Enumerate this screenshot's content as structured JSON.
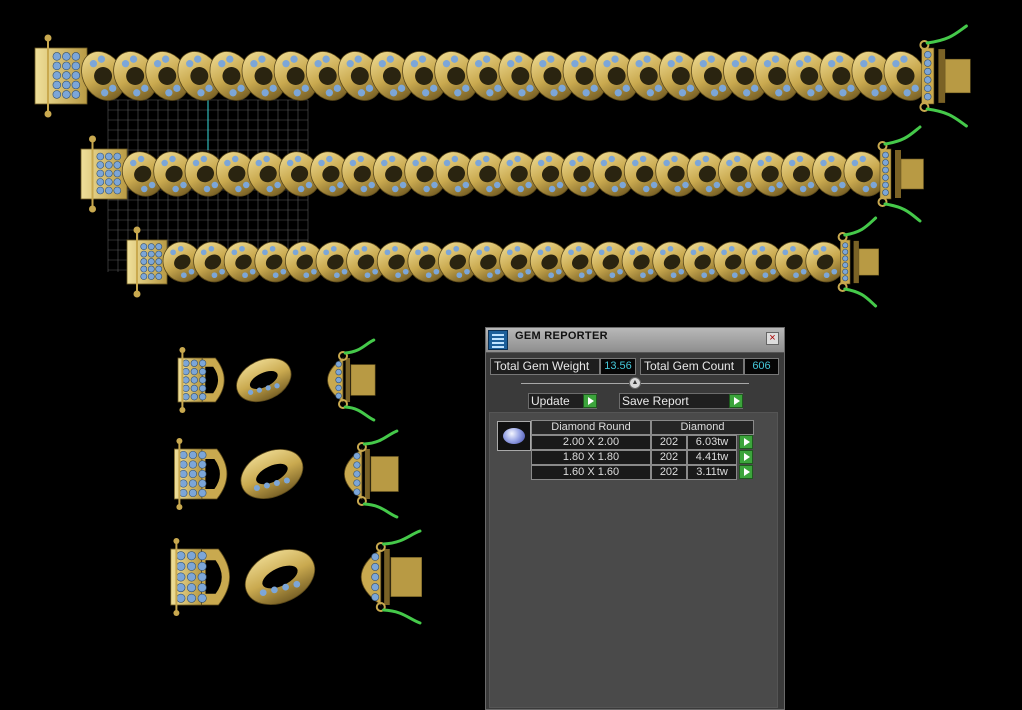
{
  "gem_reporter": {
    "title": "GEM REPORTER",
    "close_icon": "close-icon",
    "total_weight_label": "Total Gem Weight",
    "total_weight_value": "13.56",
    "total_count_label": "Total Gem Count",
    "total_count_value": "606",
    "update_label": "Update",
    "save_report_label": "Save Report",
    "table": {
      "header_shape": "Diamond Round",
      "header_material": "Diamond",
      "rows": [
        {
          "size": "2.00 X 2.00",
          "count": "202",
          "weight": "6.03tw"
        },
        {
          "size": "1.80 X 1.80",
          "count": "202",
          "weight": "4.41tw"
        },
        {
          "size": "1.60 X 1.60",
          "count": "202",
          "weight": "3.11tw"
        }
      ]
    }
  },
  "colors": {
    "gold": "#c9a94f",
    "gold_dark": "#7a6226",
    "stone": "#7ca6d8",
    "wire": "#45c94a",
    "value_text": "#45c7d9",
    "go_button": "#3ca43c"
  }
}
